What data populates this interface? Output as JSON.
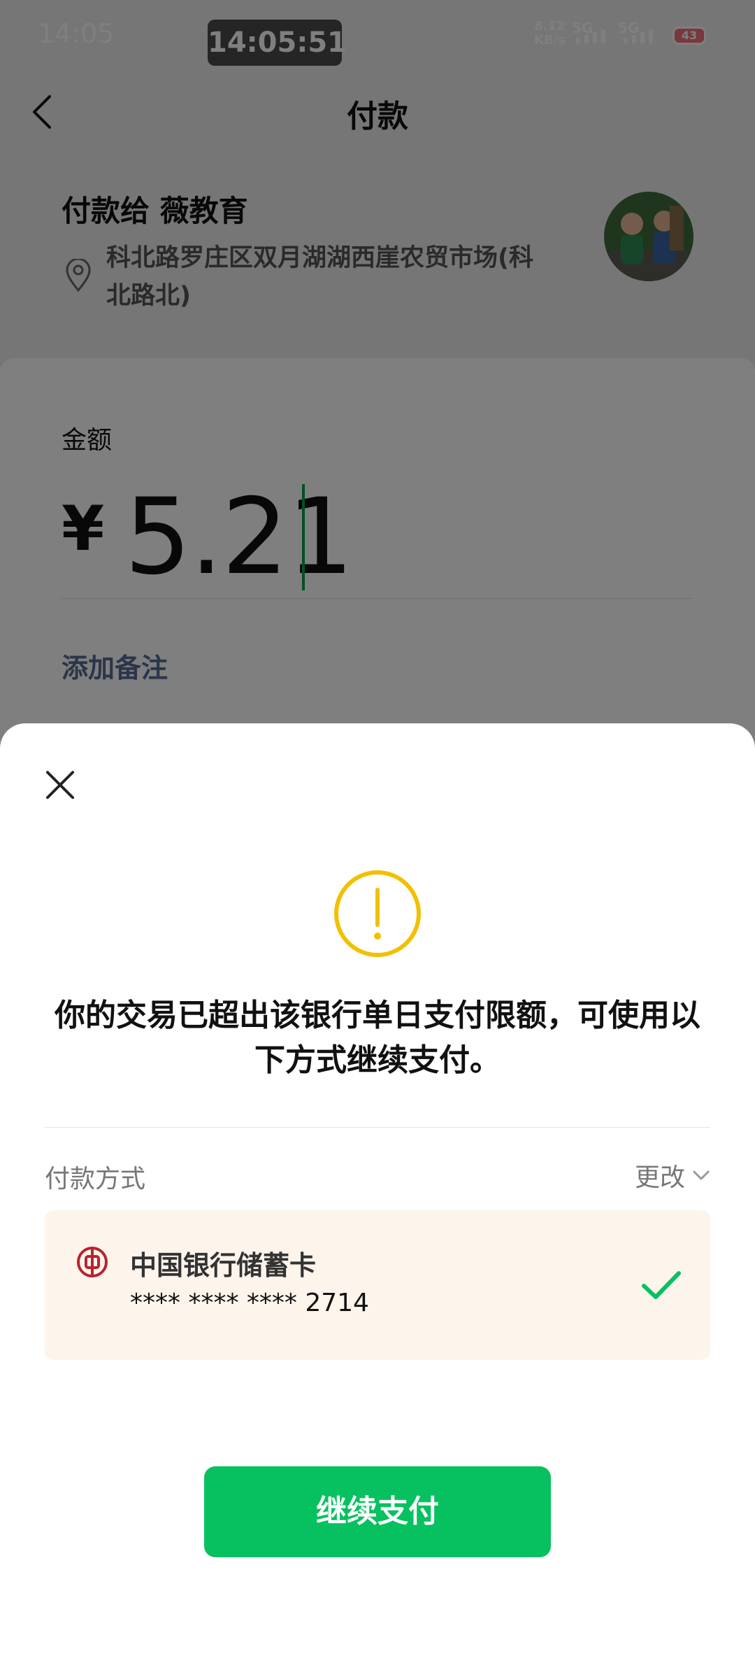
{
  "status_bar": {
    "time": "14:05",
    "clock_overlay": "14:05:51",
    "net_speed_value": "8.12",
    "net_speed_unit": "KB/s",
    "sim1": "5G",
    "sim2": "5G",
    "battery": "43"
  },
  "nav": {
    "title": "付款"
  },
  "payee": {
    "title": "付款给 薇教育",
    "address": "科北路罗庄区双月湖湖西崖农贸市场(科北路北)"
  },
  "amount": {
    "label": "金额",
    "currency": "¥",
    "value": "5.21",
    "add_note": "添加备注"
  },
  "sheet": {
    "message": "你的交易已超出该银行单日支付限额，可使用以下方式继续支付。",
    "method_label": "付款方式",
    "change_label": "更改",
    "card": {
      "bank_name": "中国银行储蓄卡",
      "masked": "**** **** ****",
      "last4": "2714",
      "selected": true
    },
    "continue_label": "继续支付"
  },
  "colors": {
    "primary_green": "#07c160",
    "warning_yellow": "#f2c000",
    "link_blue": "#576b95",
    "card_bg": "#fdf4ec",
    "bank_red": "#b8232e"
  },
  "icons": [
    "back-icon",
    "location-pin-icon",
    "close-icon",
    "warning-icon",
    "chevron-down-icon",
    "bank-of-china-icon",
    "check-icon"
  ]
}
